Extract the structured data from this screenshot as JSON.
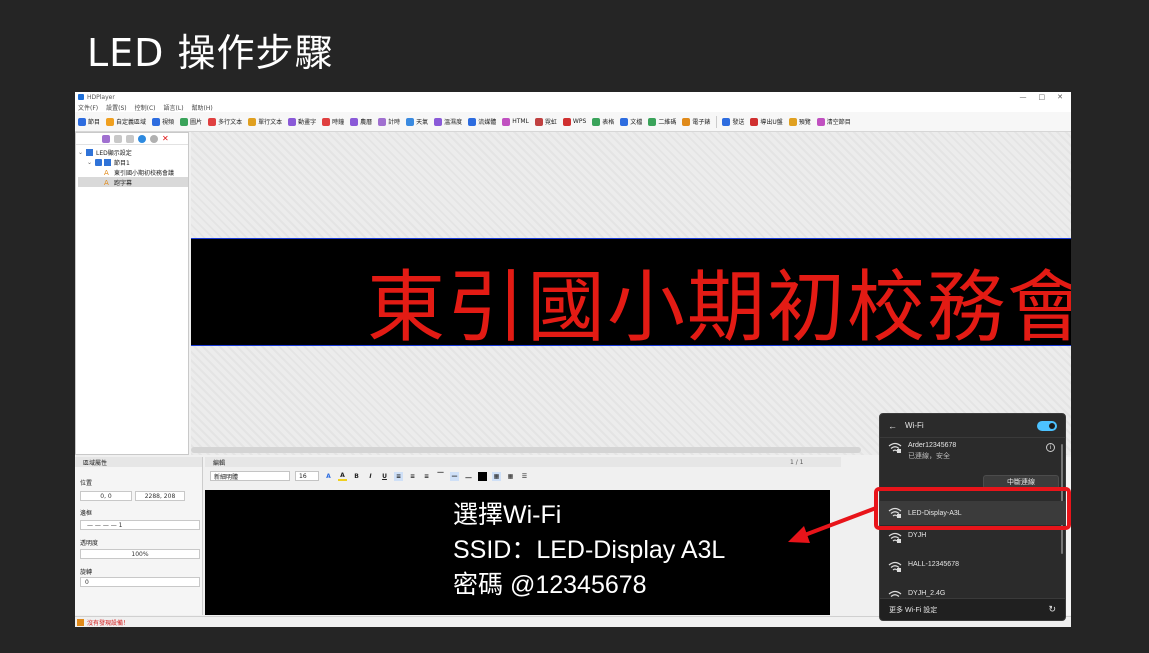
{
  "slide": {
    "title": "LED 操作步驟"
  },
  "app": {
    "window_title": "HDPlayer",
    "window_controls": [
      "—",
      "□",
      "✕"
    ],
    "menu": [
      "文件(F)",
      "設置(S)",
      "控制(C)",
      "語言(L)",
      "幫助(H)"
    ],
    "toolbar": [
      {
        "label": "節目",
        "color": "#2d6cdf"
      },
      {
        "label": "自定義區域",
        "color": "#f0a020"
      },
      {
        "label": "視頻",
        "color": "#2d6cdf"
      },
      {
        "label": "圖片",
        "color": "#3aa35a"
      },
      {
        "label": "多行文本",
        "color": "#e04040"
      },
      {
        "label": "單行文本",
        "color": "#e0a020"
      },
      {
        "label": "動畫字",
        "color": "#8a5ad8"
      },
      {
        "label": "時鐘",
        "color": "#e04040"
      },
      {
        "label": "農曆",
        "color": "#8a5ad8"
      },
      {
        "label": "計時",
        "color": "#a070d0"
      },
      {
        "label": "天氣",
        "color": "#3a8ae0"
      },
      {
        "label": "溫濕度",
        "color": "#8a5ad8"
      },
      {
        "label": "流媒體",
        "color": "#2d6cdf"
      },
      {
        "label": "HTML",
        "color": "#c050c0"
      },
      {
        "label": "霓虹",
        "color": "#c04040"
      },
      {
        "label": "WPS",
        "color": "#d03030"
      },
      {
        "label": "表格",
        "color": "#3aa35a"
      },
      {
        "label": "文檔",
        "color": "#2d6cdf"
      },
      {
        "label": "二維碼",
        "color": "#3aa35a"
      },
      {
        "label": "電子錶",
        "color": "#e08a1a"
      },
      {
        "label": "發送",
        "color": "#2d6cdf"
      },
      {
        "label": "導出U盤",
        "color": "#d03030"
      },
      {
        "label": "預覽",
        "color": "#e0a020"
      },
      {
        "label": "清空節目",
        "color": "#c050c0"
      }
    ],
    "tree": [
      {
        "label": "LED顯示設定",
        "level": 0,
        "icon": "monitor-icon"
      },
      {
        "label": "節目1",
        "level": 1,
        "icon": "program-icon"
      },
      {
        "label": "東引國小期初校務會議",
        "level": 2,
        "icon": "text-icon"
      },
      {
        "label": "跑字幕",
        "level": 2,
        "icon": "text-icon",
        "selected": true
      }
    ],
    "led_text": "東引國小期初校務會",
    "props": {
      "header": "區域屬性",
      "position_label": "位置",
      "position_value": "0, 0",
      "size_value": "2288, 208",
      "border_label": "邊框",
      "border_value": "— — — —   1",
      "opacity_label": "透明度",
      "opacity_value": "100%",
      "rotate_label": "旋轉",
      "rotate_value": "0"
    },
    "editor": {
      "header": "編輯",
      "page_indicator": "1 / 1",
      "font_name": "新細明體",
      "font_size": "16",
      "buttons": [
        "B",
        "I",
        "U"
      ]
    },
    "status": "沒有發現設備！"
  },
  "annotation": {
    "line1": "選擇Wi-Fi",
    "line2": "SSID：LED-Display A3L",
    "line3": "密碼 @12345678",
    "highlight_color": "#e8141a"
  },
  "wifi": {
    "title": "Wi-Fi",
    "networks": [
      {
        "ssid": "Arder12345678",
        "status": "已連線，安全",
        "button": "中斷連線"
      },
      {
        "ssid": "LED-Display-A3L"
      },
      {
        "ssid": "DYJH"
      },
      {
        "ssid": "HALL-12345678"
      },
      {
        "ssid": "DYJH_2.4G"
      }
    ],
    "footer": "更多 Wi-Fi 設定",
    "toggle_color": "#4cc2ff"
  }
}
